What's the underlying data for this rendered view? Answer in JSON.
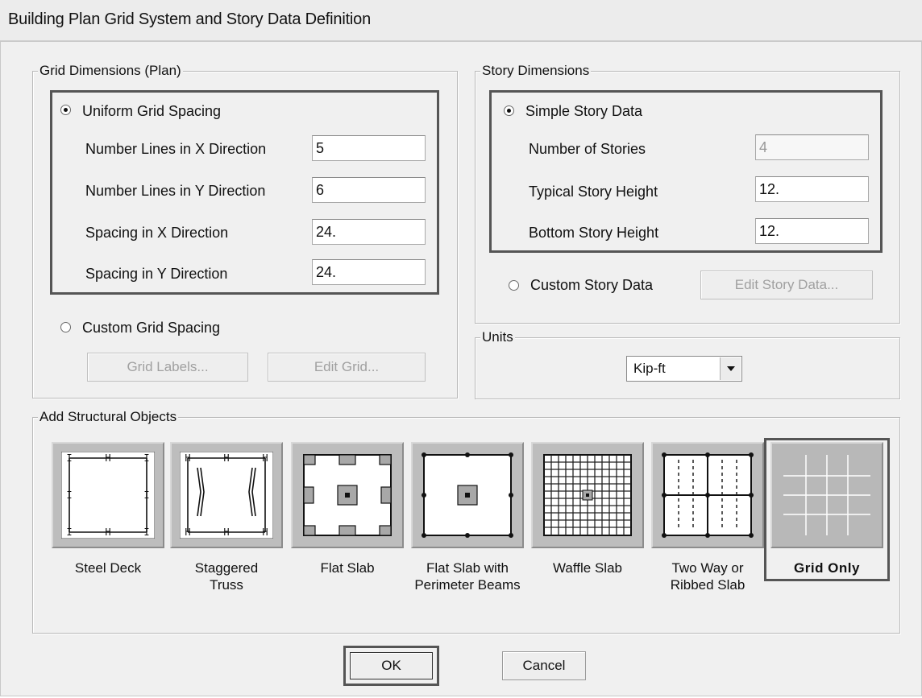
{
  "window": {
    "title": "Building Plan Grid System and Story Data Definition"
  },
  "grid_dimensions": {
    "legend": "Grid Dimensions (Plan)",
    "uniform_option": {
      "label": "Uniform Grid Spacing",
      "checked": true
    },
    "fields": [
      {
        "label": "Number Lines in X Direction",
        "value": "5"
      },
      {
        "label": "Number Lines in Y Direction",
        "value": "6"
      },
      {
        "label": "Spacing in X Direction",
        "value": "24."
      },
      {
        "label": "Spacing in Y Direction",
        "value": "24."
      }
    ],
    "custom_option": {
      "label": "Custom Grid Spacing",
      "checked": false
    },
    "grid_labels_button": "Grid Labels...",
    "edit_grid_button": "Edit Grid..."
  },
  "story_dimensions": {
    "legend": "Story Dimensions",
    "simple_option": {
      "label": "Simple Story Data",
      "checked": true
    },
    "fields": [
      {
        "label": "Number of Stories",
        "value": "4",
        "disabled": true
      },
      {
        "label": "Typical Story Height",
        "value": "12."
      },
      {
        "label": "Bottom Story Height",
        "value": "12."
      }
    ],
    "custom_option": {
      "label": "Custom Story Data",
      "checked": false
    },
    "edit_story_button": "Edit Story Data..."
  },
  "units": {
    "legend": "Units",
    "selected": "Kip-ft"
  },
  "structural_objects": {
    "legend": "Add Structural Objects",
    "items": [
      {
        "label": "Steel Deck",
        "icon": "steel-deck-icon"
      },
      {
        "label": "Staggered\nTruss",
        "icon": "staggered-truss-icon"
      },
      {
        "label": "Flat Slab",
        "icon": "flat-slab-icon"
      },
      {
        "label": "Flat Slab with\nPerimeter Beams",
        "icon": "flat-slab-perimeter-beams-icon"
      },
      {
        "label": "Waffle Slab",
        "icon": "waffle-slab-icon"
      },
      {
        "label": "Two Way or\nRibbed Slab",
        "icon": "two-way-ribbed-slab-icon"
      },
      {
        "label": "Grid Only",
        "icon": "grid-only-icon",
        "selected": true
      }
    ]
  },
  "buttons": {
    "ok": "OK",
    "cancel": "Cancel"
  }
}
